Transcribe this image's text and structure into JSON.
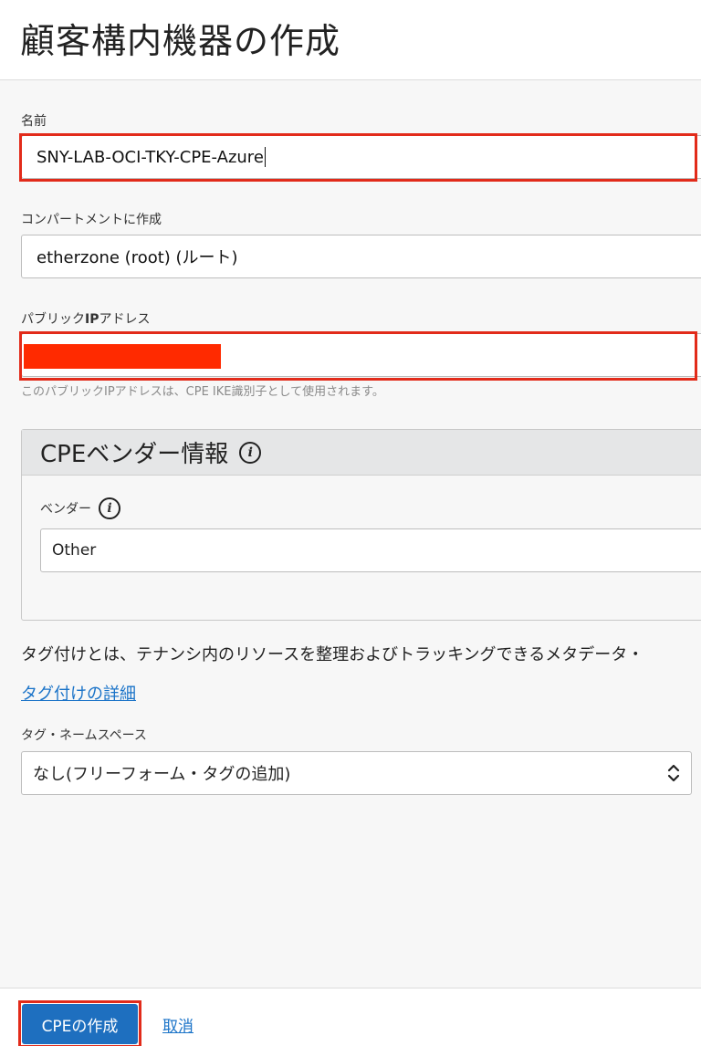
{
  "page": {
    "title": "顧客構内機器の作成"
  },
  "form": {
    "name": {
      "label": "名前",
      "value": "SNY-LAB-OCI-TKY-CPE-Azure"
    },
    "compartment": {
      "label": "コンパートメントに作成",
      "value": "etherzone (root) (ルート)"
    },
    "public_ip": {
      "label_prefix": "パブリック",
      "label_bold": "IP",
      "label_suffix": "アドレス",
      "helper": "このパブリックIPアドレスは、CPE IKE識別子として使用されます。"
    }
  },
  "vendor_panel": {
    "title": "CPEベンダー情報",
    "vendor_label": "ベンダー",
    "vendor_value": "Other"
  },
  "tags": {
    "description": "タグ付けとは、テナンシ内のリソースを整理およびトラッキングできるメタデータ・",
    "link": "タグ付けの詳細",
    "namespace_label": "タグ・ネームスペース",
    "namespace_value": "なし(フリーフォーム・タグの追加)"
  },
  "footer": {
    "create_label": "CPEの作成",
    "cancel_label": "取消"
  },
  "colors": {
    "accent": "#1e6fbf",
    "highlight": "#e22b1a",
    "redaction": "#ff2a00"
  }
}
